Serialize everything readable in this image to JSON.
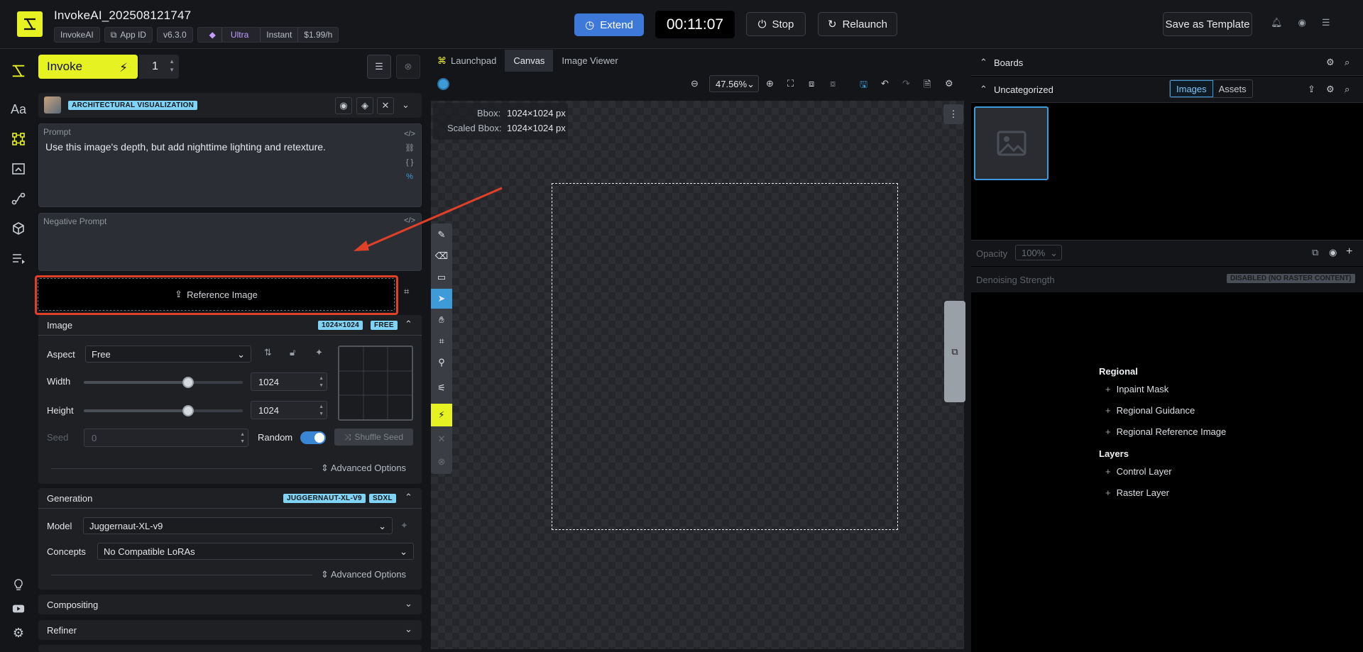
{
  "header": {
    "app_title": "InvokeAI_202508121747",
    "chip_app": "InvokeAI",
    "chip_appid": "App ID",
    "chip_version": "v6.3.0",
    "plan_name": "Ultra",
    "plan_speed": "Instant",
    "plan_price": "$1.99/h",
    "extend_label": "Extend",
    "timer": "00:11:07",
    "stop_label": "Stop",
    "relaunch_label": "Relaunch",
    "save_template_label": "Save as Template"
  },
  "panel": {
    "invoke_label": "Invoke",
    "batch_count": "1",
    "style_tag": "ARCHITECTURAL VISUALIZATION",
    "prompt_label": "Prompt",
    "prompt_value": "Use this image's depth, but add nighttime lighting and retexture.",
    "negative_label": "Negative Prompt",
    "negative_value": "",
    "reference_label": "Reference Image",
    "image_section": {
      "title": "Image",
      "size_tag": "1024×1024",
      "free_tag": "FREE",
      "aspect_label": "Aspect",
      "aspect_value": "Free",
      "width_label": "Width",
      "width_value": "1024",
      "height_label": "Height",
      "height_value": "1024",
      "seed_label": "Seed",
      "seed_value": "0",
      "random_label": "Random",
      "shuffle_label": "Shuffle Seed",
      "advanced_label": "Advanced Options"
    },
    "generation": {
      "title": "Generation",
      "model_tag": "JUGGERNAUT-XL-V9",
      "arch_tag": "SDXL",
      "model_label": "Model",
      "model_value": "Juggernaut-XL-v9",
      "concepts_label": "Concepts",
      "concepts_value": "No Compatible LoRAs",
      "advanced_label": "Advanced Options"
    },
    "compositing_label": "Compositing",
    "refiner_label": "Refiner"
  },
  "tabs": [
    "Launchpad",
    "Canvas",
    "Image Viewer"
  ],
  "canvas": {
    "zoom": "47.56%",
    "bbox_label": "Bbox:",
    "bbox_value": "1024×1024 px",
    "scaled_label": "Scaled Bbox:",
    "scaled_value": "1024×1024 px"
  },
  "right": {
    "boards_label": "Boards",
    "uncategorized_label": "Uncategorized",
    "images_tab": "Images",
    "assets_tab": "Assets",
    "opacity_label": "Opacity",
    "opacity_value": "100%",
    "denoise_label": "Denoising Strength",
    "denoise_badge": "DISABLED (NO RASTER CONTENT)",
    "regional_header": "Regional",
    "regional_items": [
      "Inpaint Mask",
      "Regional Guidance",
      "Regional Reference Image"
    ],
    "layers_header": "Layers",
    "layer_items": [
      "Control Layer",
      "Raster Layer"
    ]
  },
  "colors": {
    "accent_yellow": "#e7f222",
    "accent_blue": "#3e78d8",
    "highlight_red": "#e04028"
  }
}
